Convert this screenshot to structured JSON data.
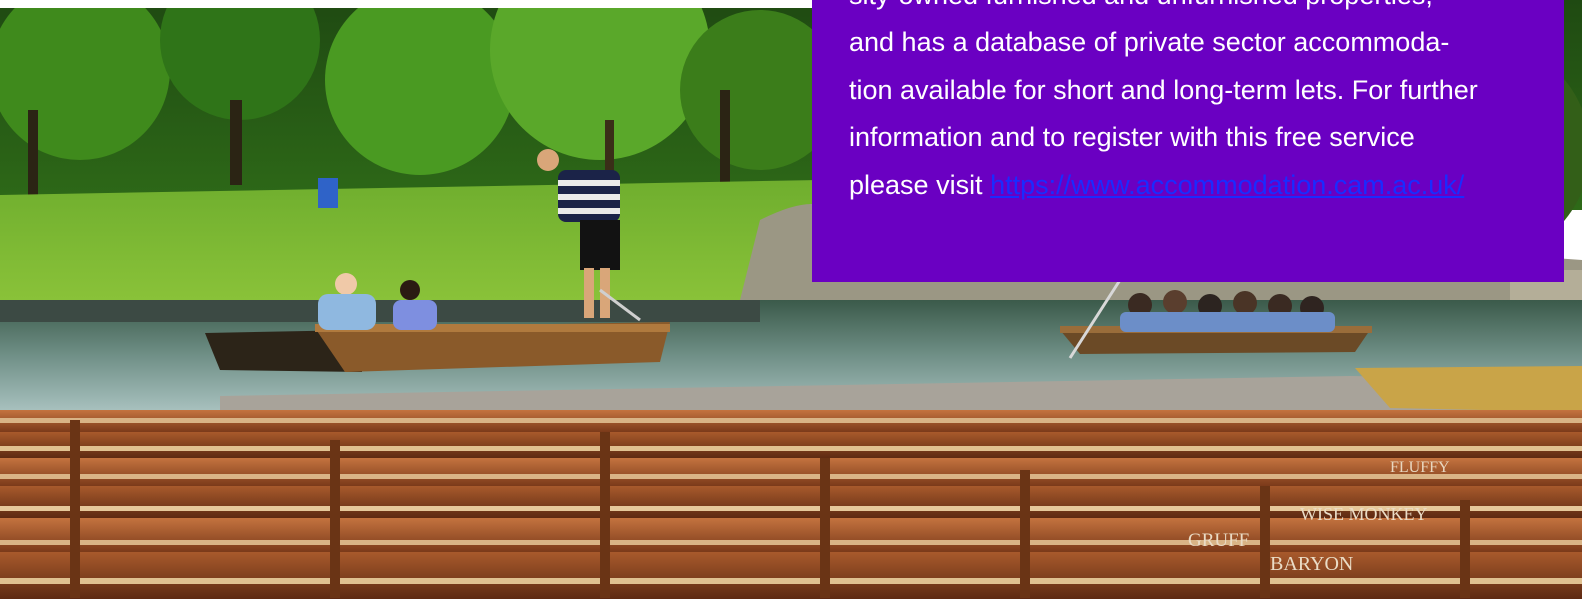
{
  "info_panel": {
    "lines": [
      "sity-owned furnished and unfurnished properties,",
      "and has a database of private sector accommoda-",
      "tion available for short and long-term lets. For further",
      "information and to register with this free service"
    ],
    "last_line_prefix": "please visit ",
    "link_text": "https://www.accommodation.cam.ac.uk/",
    "background_color": "#6a00c2",
    "text_color": "#ffffff",
    "link_color": "#1a2bff"
  },
  "photo": {
    "boat_names": [
      "WISE MONKEY",
      "GRUFF",
      "BARYON",
      "FLUFFY"
    ]
  }
}
